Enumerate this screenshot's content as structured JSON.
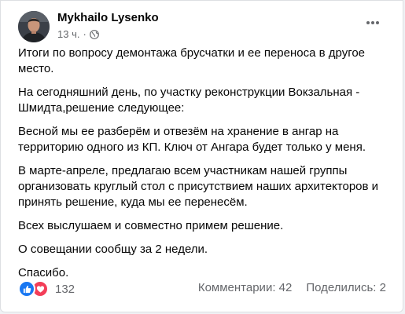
{
  "post": {
    "author": "Mykhailo Lysenko",
    "time": "13 ч.",
    "dot": "·",
    "paragraphs": [
      "Итоги по вопросу демонтажа брусчатки и ее переноса в другое место.",
      "На сегодняшний день, по участку реконструкции Вокзальная - Шмидта,решение следующее:",
      "Весной мы ее разберём и отвезём на хранение в ангар на территорию одного из КП. Ключ от Ангара будет только у меня.",
      "В марте-апреле, предлагаю всем участникам нашей группы организовать круглый стол с присутствием наших архитекторов и принять решение, куда мы ее перенесём.",
      "Всех выслушаем и совместно примем решение.",
      "О совещании сообщу за 2 недели.",
      "Спасибо."
    ]
  },
  "footer": {
    "reaction_count": "132",
    "comments": "Комментарии: 42",
    "shares": "Поделились: 2",
    "reaction_icons": [
      "like-icon",
      "love-icon"
    ]
  },
  "icons": {
    "privacy": "globe-icon",
    "menu": "more-options-icon"
  },
  "colors": {
    "like": "#1877f2",
    "love": "#f33e58",
    "secondary_text": "#65676b"
  }
}
